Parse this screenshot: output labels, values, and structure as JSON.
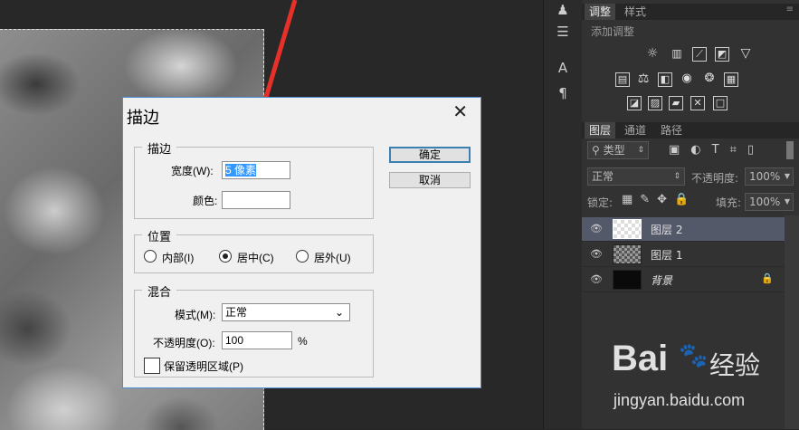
{
  "right_panel": {
    "adjust_tabs": [
      "调整",
      "样式"
    ],
    "adjust_title": "添加调整",
    "layer_tabs": [
      "图层",
      "通道",
      "路径"
    ],
    "filter_label": "类型",
    "blend_mode": "正常",
    "opacity_label": "不透明度:",
    "opacity_value": "100%",
    "lock_label": "锁定:",
    "fill_label": "填充:",
    "fill_value": "100%",
    "layers": [
      {
        "name": "图层 2",
        "selected": true
      },
      {
        "name": "图层 1",
        "selected": false
      },
      {
        "name": "背景",
        "selected": false
      }
    ]
  },
  "dialog": {
    "title": "描边",
    "close_glyph": "✕",
    "stroke_group": "描边",
    "width_label": "宽度(W):",
    "width_value": "5 像素",
    "color_label": "颜色:",
    "position_group": "位置",
    "pos_inside": "内部(I)",
    "pos_center": "居中(C)",
    "pos_outside": "居外(U)",
    "position_selected": "center",
    "blend_group": "混合",
    "mode_label": "模式(M):",
    "mode_value": "正常",
    "opacity_label": "不透明度(O):",
    "opacity_value": "100",
    "opacity_unit": "%",
    "preserve_label": "保留透明区域(P)",
    "ok_label": "确定",
    "cancel_label": "取消"
  },
  "watermark": {
    "brand": "Bai",
    "brand_cn": "经验",
    "url": "jingyan.baidu.com"
  },
  "colors": {
    "arrow": "#e8302a",
    "selected_layer": "#54596a",
    "dialog_border": "#4a90d9"
  }
}
